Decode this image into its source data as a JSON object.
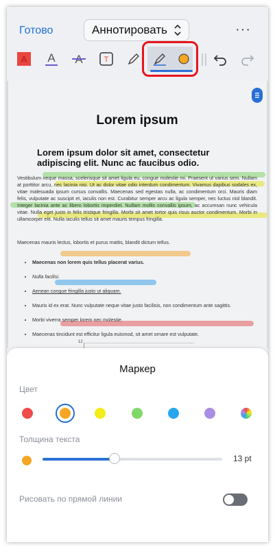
{
  "topbar": {
    "done_label": "Готово",
    "mode_label": "Аннотировать",
    "more_label": "···"
  },
  "toolbar": {
    "tools": [
      "text-box-red-icon",
      "text-color-icon",
      "strikethrough-icon",
      "text-insert-icon",
      "pencil-icon",
      "highlighter-icon",
      "color-dot-icon",
      "undo-icon",
      "redo-icon"
    ],
    "selected_tool": "highlighter-icon",
    "accent_color": "#2a6fd6",
    "selection_outline_color": "#e8141c"
  },
  "document": {
    "title": "Lorem ipsum",
    "subtitle": "Lorem ipsum dolor sit amet, consectetur adipiscing elit. Nunc ac faucibus odio.",
    "paragraph1": "Vestibulum neque massa, scelerisque sit amet ligula eu, congue molestie mi. Praesent ut varius sem. Nullam at porttitor arcu, nec lacinia nisi. Ut ac dolor vitae odio interdum condimentum. Vivamus dapibus sodales ex, vitae malesuada ipsum cursus convallis. Maecenas sed egestas nulla, ac condimentum orci. Mauris diam felis, vulputate ac suscipit et, iaculis non est. Curabitur semper arcu ac ligula semper, nec luctus nisl blandit. Integer lacinia ante ac libero lobortis imperdiet. Nullam mollis convallis ipsum, ac accumsan nunc vehicula vitae. Nulla eget justo in felis tristique fringilla. Morbi sit amet tortor quis risus auctor condimentum. Morbi in ullamcorper elit. Nulla iaculis tellus sit amet mauris tempus fringilla.",
    "paragraph2": "Maecenas mauris lectus, lobortis et purus mattis, blandit dictum tellus.",
    "list": [
      "Maecenas non lorem quis tellus placerat varius.",
      "Nulla facilisi.",
      "Aenean congue fringilla justo ut aliquam.",
      "Mauris id ex erat. Nunc vulputate neque vitae justo facilisis, non condimentum ante sagittis.",
      "Morbi viverra semper lorem nec molestie.",
      "Maecenas tincidunt est efficitur ligula euismod, sit amet ornare est vulputate."
    ],
    "chart_peek_tick": "12",
    "highlight_colors": {
      "green": "#7fd36a",
      "yellow": "#e3e227",
      "orange": "#f2a93a",
      "blue": "#3fa4e8",
      "red": "#e05b5b"
    }
  },
  "sheet": {
    "title": "Маркер",
    "color_label": "Цвет",
    "colors": [
      {
        "name": "red",
        "hex": "#f04b4b"
      },
      {
        "name": "orange",
        "hex": "#f5a623"
      },
      {
        "name": "yellow",
        "hex": "#f3ec17"
      },
      {
        "name": "green",
        "hex": "#7ed86a"
      },
      {
        "name": "blue",
        "hex": "#27a7ef"
      },
      {
        "name": "purple",
        "hex": "#a98ee6"
      },
      {
        "name": "rainbow",
        "hex": "multicolor"
      }
    ],
    "selected_color": "orange",
    "thickness_label": "Толщина текста",
    "thickness_value": 13,
    "thickness_fraction": 0.4,
    "thickness_unit_label": "13 pt",
    "straight_line_label": "Рисовать по прямой линии",
    "straight_line_enabled": false
  }
}
